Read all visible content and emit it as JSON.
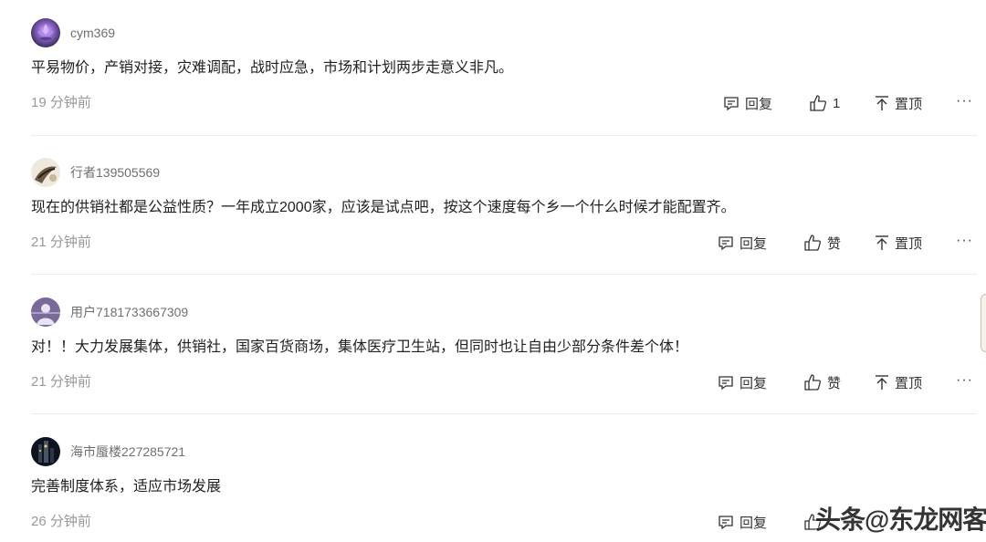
{
  "comments": [
    {
      "username": "cym369",
      "text": "平易物价，产销对接，灾难调配，战时应急，市场和计划两步走意义非凡。",
      "time": "19 分钟前",
      "reply_label": "回复",
      "like_label": "1",
      "pin_label": "置顶",
      "more_label": "···"
    },
    {
      "username": "行者139505569",
      "text": "现在的供销社都是公益性质？一年成立2000家，应该是试点吧，按这个速度每个乡一个什么时候才能配置齐。",
      "time": "21 分钟前",
      "reply_label": "回复",
      "like_label": "赞",
      "pin_label": "置顶",
      "more_label": "···"
    },
    {
      "username": "用户7181733667309",
      "text": "对！！大力发展集体，供销社，国家百货商场，集体医疗卫生站，但同时也让自由少部分条件差个体！",
      "time": "21 分钟前",
      "reply_label": "回复",
      "like_label": "赞",
      "pin_label": "置顶",
      "more_label": "···"
    },
    {
      "username": "海市蜃楼227285721",
      "text": "完善制度体系，适应市场发展",
      "time": "26 分钟前",
      "reply_label": "回复",
      "like_label": "",
      "pin_label": "",
      "more_label": ""
    }
  ],
  "watermark": "头条@东龙网客",
  "icons": {
    "reply": "comment-reply-icon",
    "like": "thumbs-up-icon",
    "pin": "pin-to-top-icon"
  }
}
